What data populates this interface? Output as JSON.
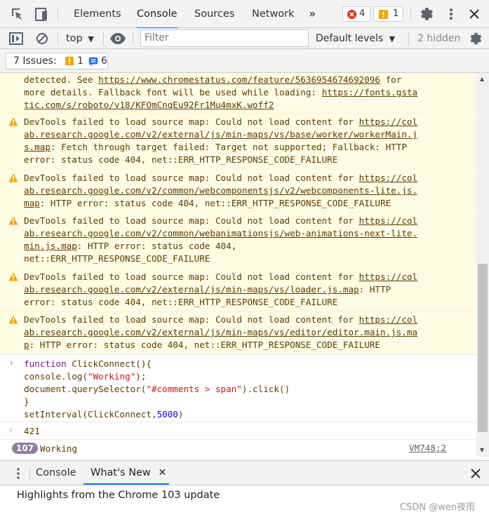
{
  "tabs": [
    "Elements",
    "Console",
    "Sources",
    "Network"
  ],
  "errors_count": "4",
  "warnings_count": "1",
  "toolbar": {
    "context": "top",
    "filter_placeholder": "Filter",
    "levels": "Default levels",
    "hidden": "2 hidden"
  },
  "issues": {
    "label": "7 Issues:",
    "warn_count": "1",
    "info_count": "6"
  },
  "messages": [
    {
      "lines": [
        "detected. See ",
        "more details. Fallback font will be used while loading: ",
        "tic.com/s/roboto/v18/KFOmCnqEu92Fr1Mu4mxK.woff2"
      ],
      "link1": "https://www.chromestatus.com/feature/5636954674692096",
      "tail1": " for",
      "link2": "https://fonts.gsta"
    },
    {
      "text": [
        "DevTools failed to load source map: Could not load content for ",
        "ab.research.google.com/v2/external/js/min-maps/vs/base/worker/workerMain.j",
        "s.map",
        ": Fetch through target failed: Target not supported; Fallback: HTTP",
        "error: status code 404, net::ERR_HTTP_RESPONSE_CODE_FAILURE"
      ],
      "link": "https://col"
    },
    {
      "text": [
        "DevTools failed to load source map: Could not load content for ",
        "ab.research.google.com/v2/common/webcomponentsjs/v2/webcomponents-lite.js.",
        "map",
        ": HTTP error: status code 404, net::ERR_HTTP_RESPONSE_CODE_FAILURE"
      ],
      "link": "https://col"
    },
    {
      "text": [
        "DevTools failed to load source map: Could not load content for ",
        "ab.research.google.com/v2/common/webanimationsjs/web-animations-next-lite.",
        "min.js.map",
        ": HTTP error: status code 404,",
        "net::ERR_HTTP_RESPONSE_CODE_FAILURE"
      ],
      "link": "https://col"
    },
    {
      "text": [
        "DevTools failed to load source map: Could not load content for ",
        "ab.research.google.com/v2/external/js/min-maps/vs/loader.js.map",
        ": HTTP",
        "error: status code 404, net::ERR_HTTP_RESPONSE_CODE_FAILURE"
      ],
      "link": "https://col"
    },
    {
      "text": [
        "DevTools failed to load source map: Could not load content for ",
        "ab.research.google.com/v2/external/js/min-maps/vs/editor/editor.main.js.ma",
        "p",
        ": HTTP error: status code 404, net::ERR_HTTP_RESPONSE_CODE_FAILURE"
      ],
      "link": "https://col"
    }
  ],
  "code": {
    "l1a": "function",
    "l1b": " ClickConnect(){",
    "l2a": "console.log(",
    "l2b": "\"Working\"",
    "l2c": ");",
    "l3a": "document.querySelector(",
    "l3b": "\"#comments > span\"",
    "l3c": ").click()",
    "l4": "}",
    "l5a": "setInterval(ClickConnect,",
    "l5b": "5000",
    "l5c": ")"
  },
  "result": "421",
  "log": {
    "count": "107",
    "text": "Working",
    "source": "VM748:2"
  },
  "drawer": {
    "tab_console": "Console",
    "tab_whatsnew": "What's New",
    "highlight": "Highlights from the Chrome 103 update"
  },
  "watermark": "CSDN @wen夜雨"
}
